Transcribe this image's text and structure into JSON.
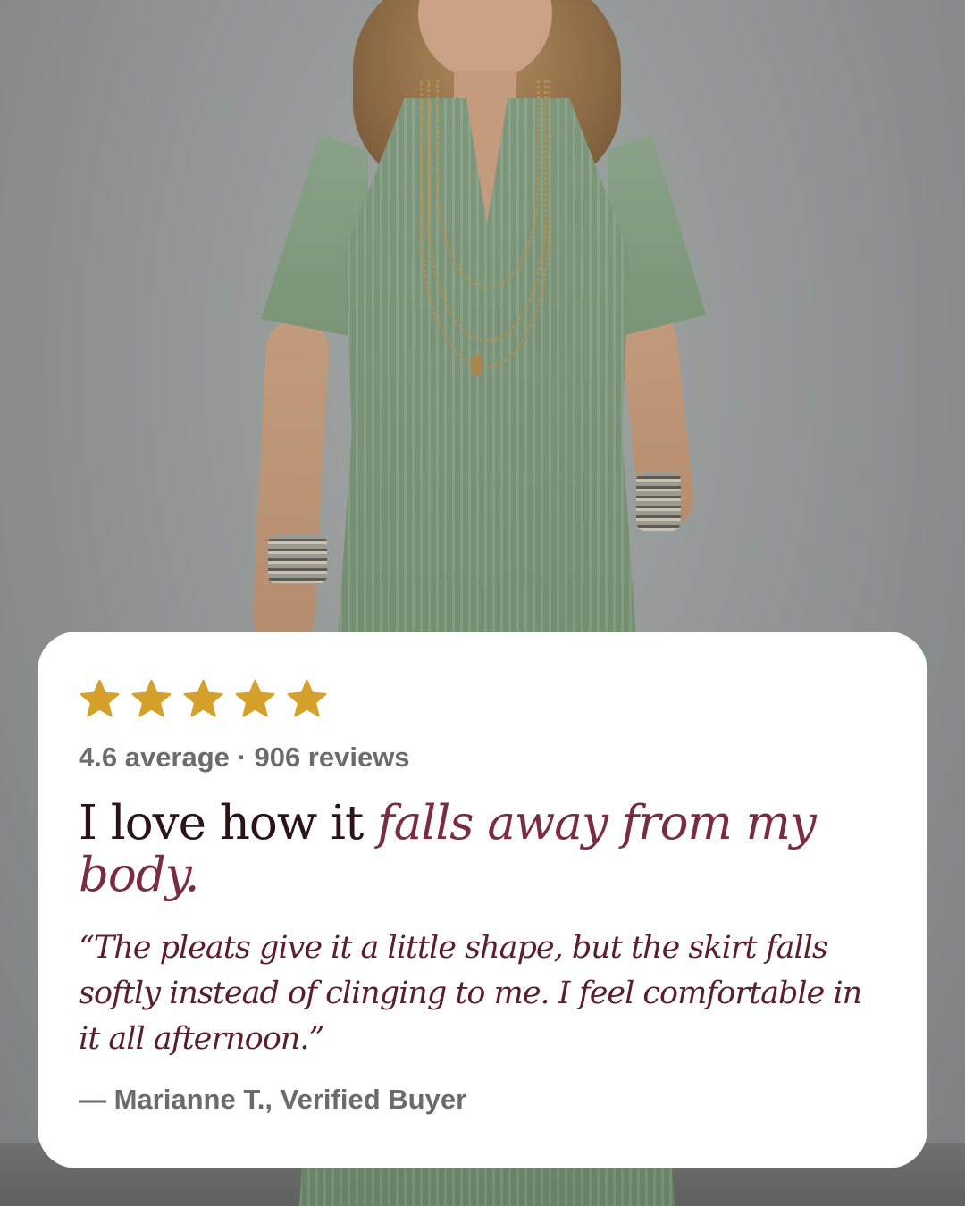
{
  "rating": {
    "stars_filled": 5,
    "stars_total": 5,
    "star_color": "#d5a12b",
    "summary": "4.6 average · 906 reviews"
  },
  "review": {
    "headline_plain": "I love how it ",
    "headline_emphasis": "falls away from my body.",
    "quote": "“The pleats give it a little shape, but the skirt falls softly instead of clinging to me. I feel comfortable in it all afternoon.”",
    "attribution": "— Marianne T., Verified Buyer"
  },
  "colors": {
    "headline_text": "#2a1418",
    "emphasis_text": "#7a2c45",
    "quote_text": "#5b1e2c",
    "muted_text": "#6b6b6b",
    "card_background": "#ffffff",
    "dress_green": "#7b9679"
  }
}
